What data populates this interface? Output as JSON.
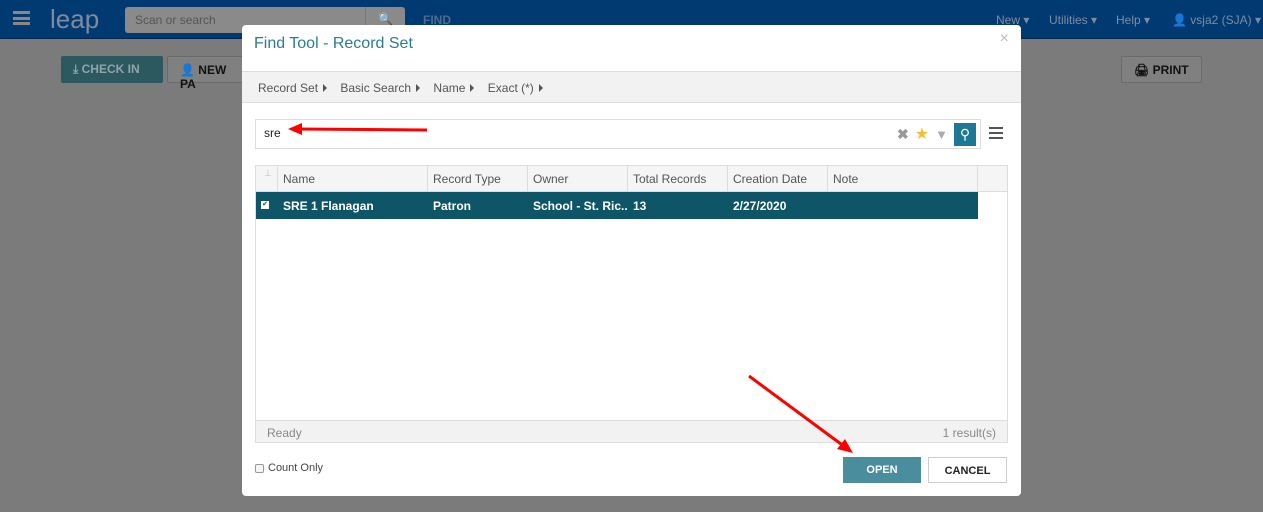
{
  "topbar": {
    "logo": "leap",
    "search_placeholder": "Scan or search",
    "find_label": "FIND",
    "nav": [
      "New",
      "Utilities",
      "Help"
    ],
    "user": "vsja2 (SJA)"
  },
  "background": {
    "check_in": "CHECK IN",
    "new_patron": "NEW PA",
    "print": "PRINT"
  },
  "modal": {
    "title": "Find Tool - Record Set",
    "close": "×",
    "breadcrumbs": [
      "Record Set",
      "Basic Search",
      "Name",
      "Exact (*)"
    ],
    "search_value": "sre",
    "columns": [
      "Name",
      "Record Type",
      "Owner",
      "Total Records",
      "Creation Date",
      "Note"
    ],
    "rows": [
      {
        "name": "SRE 1 Flanagan",
        "record_type": "Patron",
        "owner": "School - St. Ric...",
        "total_records": "13",
        "creation_date": "2/27/2020",
        "note": "",
        "selected": true
      }
    ],
    "status": "Ready",
    "result_count": "1 result(s)",
    "count_only": "Count Only",
    "open": "OPEN",
    "cancel": "CANCEL"
  },
  "colors": {
    "header": "#013a70",
    "accent": "#2a7d91",
    "selected_row": "#0e5667",
    "open_button": "#4a8d9c",
    "annotation": "#ff0000"
  }
}
